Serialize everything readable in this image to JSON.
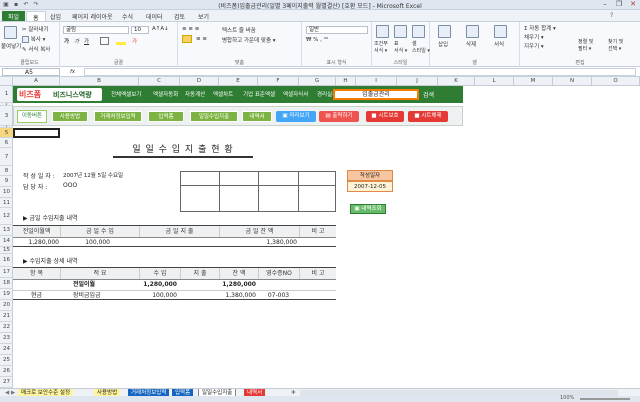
{
  "window": {
    "title": "(비즈폼)입출금관리(일별 3페이지출력 월별결산) [호환 모드] - Microsoft Excel"
  },
  "ribbon_tabs": [
    "파일",
    "홈",
    "삽입",
    "페이지 레이아웃",
    "수식",
    "데이터",
    "검토",
    "보기"
  ],
  "ribbon": {
    "clipboard": {
      "paste": "붙여넣기",
      "cut": "잘라내기",
      "copy": "복사 ▾",
      "format_painter": "서식 복사",
      "label": "클립보드"
    },
    "font": {
      "name": "굴림",
      "size": "10",
      "label": "글꼴"
    },
    "alignment": {
      "wrap": "텍스트 줄 바꿈",
      "merge": "병합하고 가운데 맞춤 ▾",
      "label": "맞춤"
    },
    "number": {
      "format": "일반",
      "label": "표시 형식"
    },
    "styles": {
      "conditional": "조건부\n서식 ▾",
      "table": "표\n서식 ▾",
      "cell": "셀\n스타일 ▾",
      "label": "스타일"
    },
    "cells": {
      "insert": "삽입",
      "delete": "삭제",
      "format": "서식",
      "label": "셀"
    },
    "editing": {
      "autosum": "Σ 자동 합계 ▾",
      "fill": "채우기 ▾",
      "clear": "지우기 ▾",
      "sort": "정렬 및\n필터 ▾",
      "find": "찾기 및\n선택 ▾",
      "label": "편집"
    }
  },
  "formula_bar": {
    "cell": "A5",
    "fx": "fx"
  },
  "columns": [
    "A",
    "B",
    "C",
    "D",
    "E",
    "F",
    "G",
    "H",
    "I",
    "J",
    "K",
    "L",
    "M",
    "N",
    "O"
  ],
  "rows": [
    "1",
    "2",
    "3",
    "4",
    "5",
    "6",
    "7",
    "8",
    "9",
    "10",
    "11",
    "12",
    "13",
    "14",
    "15",
    "16",
    "17",
    "18",
    "19",
    "20",
    "21",
    "22",
    "23",
    "24",
    "25",
    "26",
    "27",
    "28"
  ],
  "header_bar": {
    "logo_a": "비즈폼",
    "logo_b": "비즈니스역량",
    "menu": [
      "전체엑셀보기",
      "엑셀자동화",
      "자동계산",
      "엑셀차트",
      "기업 표준엑셀",
      "엑셀자식사",
      "경리실무"
    ],
    "search_value": "입출금관리",
    "search_button": "검색"
  },
  "button_bar": {
    "label": "이동버튼",
    "green": [
      "사용방법",
      "거래처정보입력",
      "입력폼",
      "일일수입지출",
      "내역서"
    ],
    "preview": "미리보기",
    "print": "출력하기",
    "protect": "시트보호",
    "unprotect": "시트해제"
  },
  "report": {
    "title": "일 일 수 입 지 출 현 황",
    "date_label": "작 성 일 자 :",
    "date_value": "2007년 12월 5일 수요일",
    "person_label": "담 당 자 :",
    "person_value": "OOO",
    "side_label": "작성일자",
    "side_value": "2007-12-05",
    "lookup_button": "내역조회",
    "summary_title": "▶ 금일 수입지출 내역",
    "summary_headers": [
      "전일이월액",
      "금 일 수 입",
      "금 일 지 출",
      "금 일 잔 액",
      "비 고"
    ],
    "summary_values": [
      "1,280,000",
      "100,000",
      "",
      "1,380,000",
      ""
    ],
    "detail_title": "▶ 수입지출 상세 내역",
    "detail_headers": [
      "항 목",
      "적 요",
      "수 입",
      "지 출",
      "잔 액",
      "영수증NO",
      "비 고"
    ],
    "detail_rows": [
      [
        "",
        "전일이월",
        "1,280,000",
        "",
        "1,280,000",
        "",
        ""
      ],
      [
        "현금",
        "장비금입금",
        "100,000",
        "",
        "1,380,000",
        "07-003",
        ""
      ]
    ]
  },
  "sheet_tabs": [
    "매크로 보안수준 설정",
    "사용방법",
    "거래처정보입력",
    "입력폼",
    "일일수입지출",
    "내역서"
  ],
  "status": {
    "zoom": "100%"
  }
}
